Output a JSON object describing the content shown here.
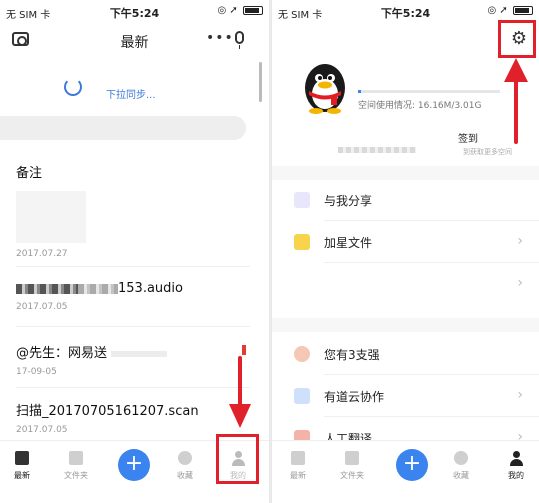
{
  "left": {
    "status": {
      "carrier": "无 SIM 卡",
      "time": "下午5:24"
    },
    "header": {
      "title": "最新"
    },
    "sync_text": "下拉同步...",
    "notes": [
      {
        "title": "备注",
        "date": "2017.07.27"
      },
      {
        "title": "153.audio",
        "date": "2017.07.05"
      },
      {
        "title": "@先生：网易送",
        "date": "17-09-05"
      },
      {
        "title": "扫描_20170705161207.scan",
        "date": "2017.07.05"
      }
    ],
    "tabs": [
      "最新",
      "文件夹",
      "收藏",
      "我的"
    ]
  },
  "right": {
    "status": {
      "carrier": "无 SIM 卡",
      "time": "下午5:24"
    },
    "storage_text": "空间使用情况: 16.16M/3.01G",
    "storage_used_fraction": 0.005,
    "signin_label": "签到",
    "signin_sub": "到获取更多空间",
    "menu": [
      {
        "label": "与我分享",
        "chevron": ""
      },
      {
        "label": "加星文件",
        "chevron": "›"
      },
      {
        "label": "",
        "chevron": "›"
      },
      {
        "label": "您有3支强",
        "chevron": ""
      },
      {
        "label": "有道云协作",
        "chevron": "›"
      },
      {
        "label": "人工翻译",
        "chevron": "›"
      }
    ],
    "tabs": [
      "最新",
      "文件夹",
      "收藏",
      "我的"
    ]
  },
  "colors": {
    "accent": "#3b83ef",
    "annotation": "#e0202a"
  }
}
